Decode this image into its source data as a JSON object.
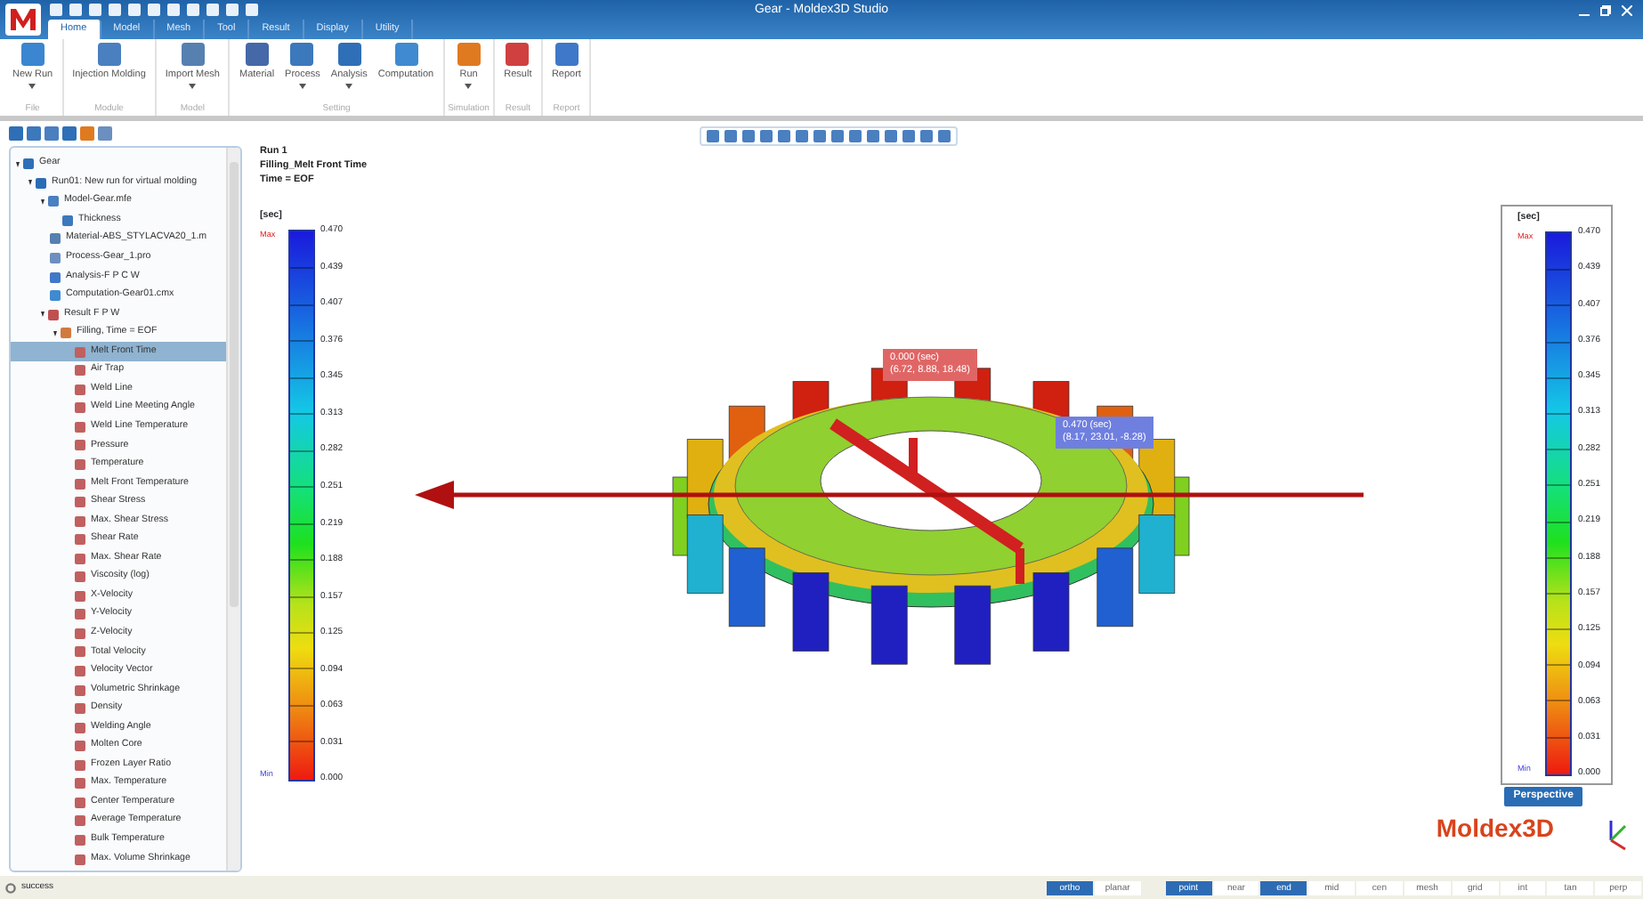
{
  "window": {
    "title": "Gear - Moldex3D Studio"
  },
  "ribbon_tabs": [
    {
      "label": "Home",
      "selected": true
    },
    {
      "label": "Model",
      "selected": false
    },
    {
      "label": "Mesh",
      "selected": false
    },
    {
      "label": "Tool",
      "selected": false
    },
    {
      "label": "Result",
      "selected": false
    },
    {
      "label": "Display",
      "selected": false
    },
    {
      "label": "Utility",
      "selected": false
    }
  ],
  "ribbon_groups": [
    {
      "label": "File",
      "buttons": [
        {
          "label": "New Run",
          "kind": "newrun",
          "dropdown": true
        }
      ]
    },
    {
      "label": "Module",
      "buttons": [
        {
          "label": "Injection Molding",
          "kind": "module",
          "dropdown": false
        }
      ]
    },
    {
      "label": "Model",
      "buttons": [
        {
          "label": "Import Mesh",
          "kind": "mesh",
          "dropdown": true
        }
      ]
    },
    {
      "label": "Setting",
      "buttons": [
        {
          "label": "Material",
          "kind": "material",
          "dropdown": false
        },
        {
          "label": "Process",
          "kind": "process",
          "dropdown": true
        },
        {
          "label": "Analysis",
          "kind": "analysis",
          "dropdown": true
        },
        {
          "label": "Computation",
          "kind": "computation",
          "dropdown": false
        }
      ]
    },
    {
      "label": "Simulation",
      "buttons": [
        {
          "label": "Run",
          "kind": "run",
          "dropdown": true
        }
      ]
    },
    {
      "label": "Result",
      "buttons": [
        {
          "label": "Result",
          "kind": "result",
          "dropdown": false
        }
      ]
    },
    {
      "label": "Report",
      "buttons": [
        {
          "label": "Report",
          "kind": "report",
          "dropdown": false
        }
      ]
    }
  ],
  "tree": [
    {
      "label": "Gear",
      "kind": "folder",
      "expanded": true,
      "selected": false,
      "children": [
        {
          "label": "Run01: New run for virtual molding",
          "kind": "run",
          "expanded": true,
          "selected": false,
          "children": [
            {
              "label": "Model-Gear.mfe",
              "kind": "model",
              "expanded": true,
              "selected": false,
              "children": [
                {
                  "label": "Thickness",
                  "kind": "thickness",
                  "selected": false
                }
              ]
            },
            {
              "label": "Material-ABS_STYLACVA20_1.m",
              "kind": "material",
              "selected": false
            },
            {
              "label": "Process-Gear_1.pro",
              "kind": "process",
              "selected": false
            },
            {
              "label": "Analysis-F P C W",
              "kind": "analysis",
              "selected": false
            },
            {
              "label": "Computation-Gear01.cmx",
              "kind": "computation",
              "selected": false
            },
            {
              "label": "Result F P W",
              "kind": "result",
              "expanded": true,
              "selected": false,
              "children": [
                {
                  "label": "Filling, Time = EOF",
                  "kind": "filling",
                  "expanded": true,
                  "selected": false,
                  "children": [
                    {
                      "label": "Melt Front Time",
                      "kind": "item",
                      "selected": true
                    },
                    {
                      "label": "Air Trap",
                      "kind": "item",
                      "selected": false
                    },
                    {
                      "label": "Weld Line",
                      "kind": "item",
                      "selected": false
                    },
                    {
                      "label": "Weld Line Meeting Angle",
                      "kind": "item",
                      "selected": false
                    },
                    {
                      "label": "Weld Line Temperature",
                      "kind": "item",
                      "selected": false
                    },
                    {
                      "label": "Pressure",
                      "kind": "item",
                      "selected": false
                    },
                    {
                      "label": "Temperature",
                      "kind": "item",
                      "selected": false
                    },
                    {
                      "label": "Melt Front Temperature",
                      "kind": "item",
                      "selected": false
                    },
                    {
                      "label": "Shear Stress",
                      "kind": "item",
                      "selected": false
                    },
                    {
                      "label": "Max. Shear Stress",
                      "kind": "item",
                      "selected": false
                    },
                    {
                      "label": "Shear Rate",
                      "kind": "item",
                      "selected": false
                    },
                    {
                      "label": "Max. Shear Rate",
                      "kind": "item",
                      "selected": false
                    },
                    {
                      "label": "Viscosity (log)",
                      "kind": "item",
                      "selected": false
                    },
                    {
                      "label": "X-Velocity",
                      "kind": "item",
                      "selected": false
                    },
                    {
                      "label": "Y-Velocity",
                      "kind": "item",
                      "selected": false
                    },
                    {
                      "label": "Z-Velocity",
                      "kind": "item",
                      "selected": false
                    },
                    {
                      "label": "Total Velocity",
                      "kind": "item",
                      "selected": false
                    },
                    {
                      "label": "Velocity Vector",
                      "kind": "item",
                      "selected": false
                    },
                    {
                      "label": "Volumetric Shrinkage",
                      "kind": "item",
                      "selected": false
                    },
                    {
                      "label": "Density",
                      "kind": "item",
                      "selected": false
                    },
                    {
                      "label": "Welding Angle",
                      "kind": "item",
                      "selected": false
                    },
                    {
                      "label": "Molten Core",
                      "kind": "item",
                      "selected": false
                    },
                    {
                      "label": "Frozen Layer Ratio",
                      "kind": "item",
                      "selected": false
                    },
                    {
                      "label": "Max. Temperature",
                      "kind": "item",
                      "selected": false
                    },
                    {
                      "label": "Center Temperature",
                      "kind": "item",
                      "selected": false
                    },
                    {
                      "label": "Average Temperature",
                      "kind": "item",
                      "selected": false
                    },
                    {
                      "label": "Bulk Temperature",
                      "kind": "item",
                      "selected": false
                    },
                    {
                      "label": "Max. Volume Shrinkage",
                      "kind": "item",
                      "selected": false
                    }
                  ]
                }
              ]
            }
          ]
        }
      ]
    }
  ],
  "viewport": {
    "info": [
      "Run 1",
      "Filling_Melt Front Time",
      "Time = EOF"
    ],
    "legends": [
      {
        "unit": "[sec]",
        "max_label": "Max",
        "min_label": "Min",
        "framed": false,
        "ticks": [
          "0.470",
          "0.439",
          "0.407",
          "0.376",
          "0.345",
          "0.313",
          "0.282",
          "0.251",
          "0.219",
          "0.188",
          "0.157",
          "0.125",
          "0.094",
          "0.063",
          "0.031",
          "0.000"
        ]
      },
      {
        "unit": "[sec]",
        "max_label": "Max",
        "min_label": "Min",
        "framed": true,
        "ticks": [
          "0.470",
          "0.439",
          "0.407",
          "0.376",
          "0.345",
          "0.313",
          "0.282",
          "0.251",
          "0.219",
          "0.188",
          "0.157",
          "0.125",
          "0.094",
          "0.063",
          "0.031",
          "0.000"
        ]
      }
    ],
    "probes": [
      {
        "value": "0.000 (sec)",
        "coords": "(6.72, 8.88, 18.48)",
        "color": "#e06666"
      },
      {
        "value": "0.470 (sec)",
        "coords": "(8.17, 23.01, -8.28)",
        "color": "#6f7fe0"
      }
    ],
    "projection": "Perspective",
    "logo": "Moldex3D"
  },
  "status_bar": {
    "message": "success",
    "toggles": [
      {
        "label": "ortho",
        "on": true
      },
      {
        "label": "planar",
        "on": false
      },
      {
        "label": "point",
        "on": true
      },
      {
        "label": "near",
        "on": false
      },
      {
        "label": "end",
        "on": true
      },
      {
        "label": "mid",
        "on": false
      },
      {
        "label": "cen",
        "on": false
      },
      {
        "label": "mesh",
        "on": false
      },
      {
        "label": "grid",
        "on": false
      },
      {
        "label": "int",
        "on": false
      },
      {
        "label": "tan",
        "on": false
      },
      {
        "label": "perp",
        "on": false
      }
    ]
  }
}
